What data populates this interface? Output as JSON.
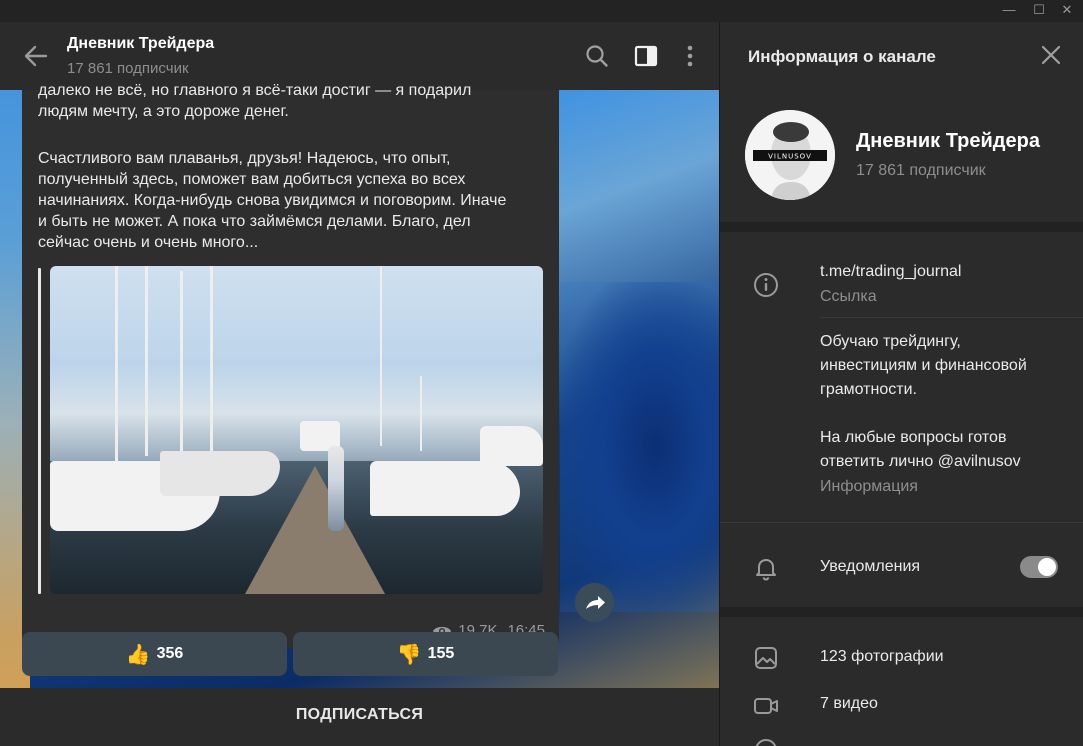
{
  "window": {
    "minimize": "—",
    "maximize": "☐",
    "close": "✕"
  },
  "chat": {
    "title": "Дневник Трейдера",
    "subscribers": "17 861 подписчик",
    "message": {
      "line_cut": "далеко не всё, но главного я всё-таки достиг — я подарил",
      "para1_end": "людям мечту, а это дороже денег.",
      "para2": "Счастливого вам плаванья, друзья! Надеюсь, что опыт,\nполученный здесь, поможет вам добиться успеха во всех\nначинаниях. Когда-нибудь снова увидимся и поговорим. Иначе\nи быть не может. А пока что займёмся делами. Благо, дел\nсейчас очень и очень много...",
      "views": "19.7K",
      "time": "16:45"
    },
    "reactions": [
      {
        "emoji": "👍",
        "count": "356"
      },
      {
        "emoji": "👎",
        "count": "155"
      }
    ],
    "subscribe_label": "ПОДПИСАТЬСЯ"
  },
  "panel": {
    "title": "Информация о канале",
    "name": "Дневник Трейдера",
    "subscribers": "17 861 подписчик",
    "avatar_text": "VILNUSOV",
    "link": "t.me/trading_journal",
    "link_label": "Ссылка",
    "description": "Обучаю трейдингу,\nинвестициям и финансовой\nграмотности.\n\nНа любые вопросы готов\nответить лично @avilnusov",
    "description_label": "Информация",
    "notifications_label": "Уведомления",
    "notifications_on": true,
    "media": [
      {
        "icon": "photo-icon",
        "label": "123 фотографии"
      },
      {
        "icon": "video-icon",
        "label": "7 видео"
      }
    ]
  }
}
